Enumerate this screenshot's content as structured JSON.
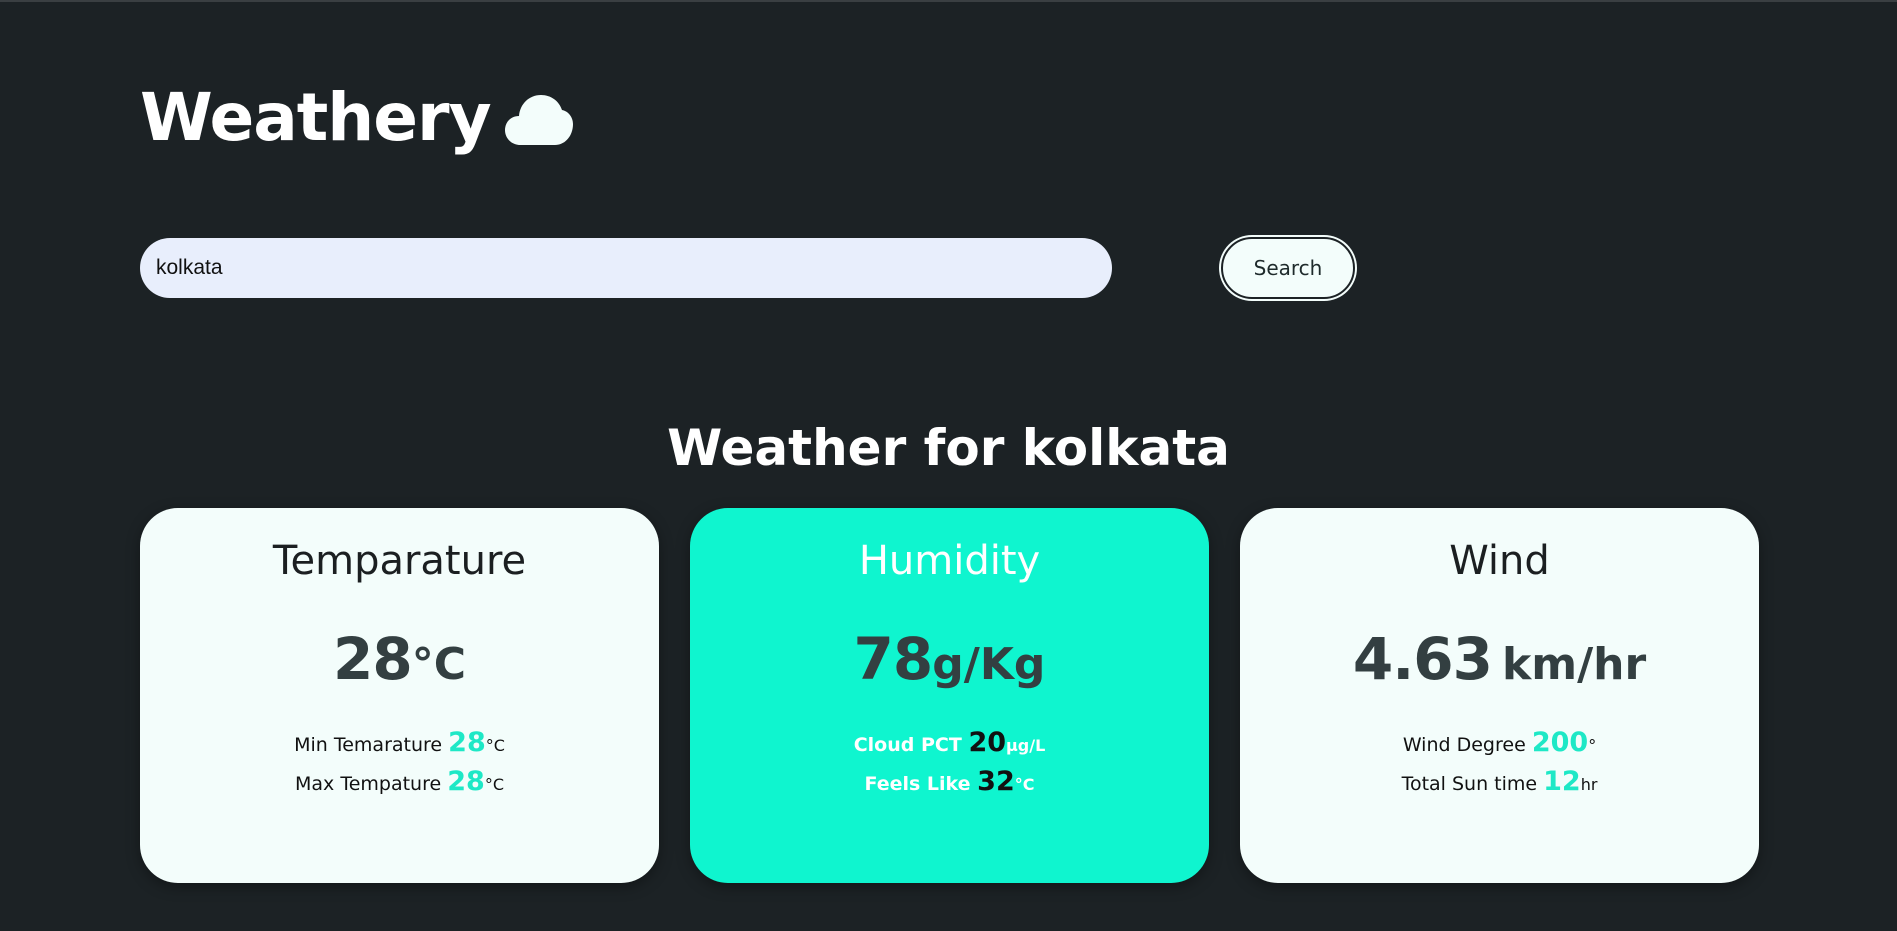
{
  "app": {
    "title": "Weathery",
    "logo_icon": "cloud-icon"
  },
  "search": {
    "value": "kolkata",
    "placeholder": "",
    "button_label": "Search"
  },
  "heading": "Weather for kolkata",
  "colors": {
    "background": "#1c2225",
    "accent": "#0ff5cf",
    "card": "#f3fdfb",
    "highlight_number": "#1ee8c6"
  },
  "cards": [
    {
      "title": "Temparature",
      "value": "28",
      "unit": "°C",
      "stats": [
        {
          "label": "Min Temarature",
          "value": "28",
          "unit": "°C"
        },
        {
          "label": "Max Tempature",
          "value": "28",
          "unit": "°C"
        }
      ]
    },
    {
      "title": "Humidity",
      "value": "78",
      "unit": "g/Kg",
      "stats": [
        {
          "label": "Cloud PCT",
          "value": "20",
          "unit": "µg/L"
        },
        {
          "label": "Feels Like",
          "value": "32",
          "unit": "°C"
        }
      ]
    },
    {
      "title": "Wind",
      "value": "4.63",
      "unit": "km/hr",
      "stats": [
        {
          "label": "Wind Degree",
          "value": "200",
          "unit": "°"
        },
        {
          "label": "Total Sun time",
          "value": "12",
          "unit": "hr"
        }
      ]
    }
  ]
}
